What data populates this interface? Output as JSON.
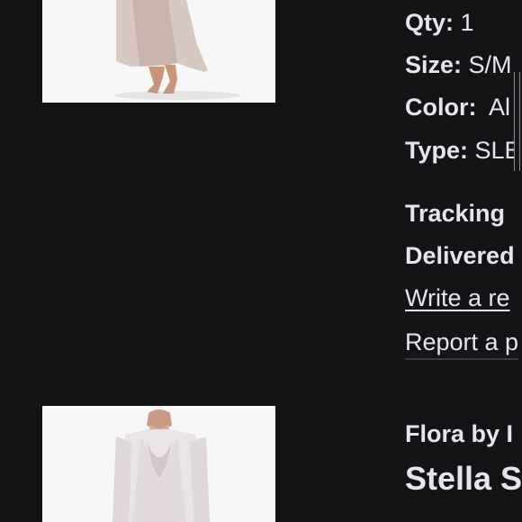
{
  "order_item_1": {
    "image_icon": "nightgown-photo",
    "qty_label": "Qty:",
    "qty_value": " 1",
    "size_label": "Size:",
    "size_value": " S/M",
    "color_label": "Color:",
    "color_value": "  Al",
    "type_label": "Type:",
    "type_value": " SLE",
    "tracking_label": "Tracking",
    "delivered_label": "Delivered",
    "write_review_link": "Write a re",
    "report_link": "Report a p"
  },
  "order_item_2": {
    "image_icon": "robe-photo",
    "brand": "Flora by I",
    "title": "Stella S"
  },
  "colors": {
    "background": "#141315",
    "text": "#e6e4ee",
    "image_bg": "#f7f7f7"
  }
}
